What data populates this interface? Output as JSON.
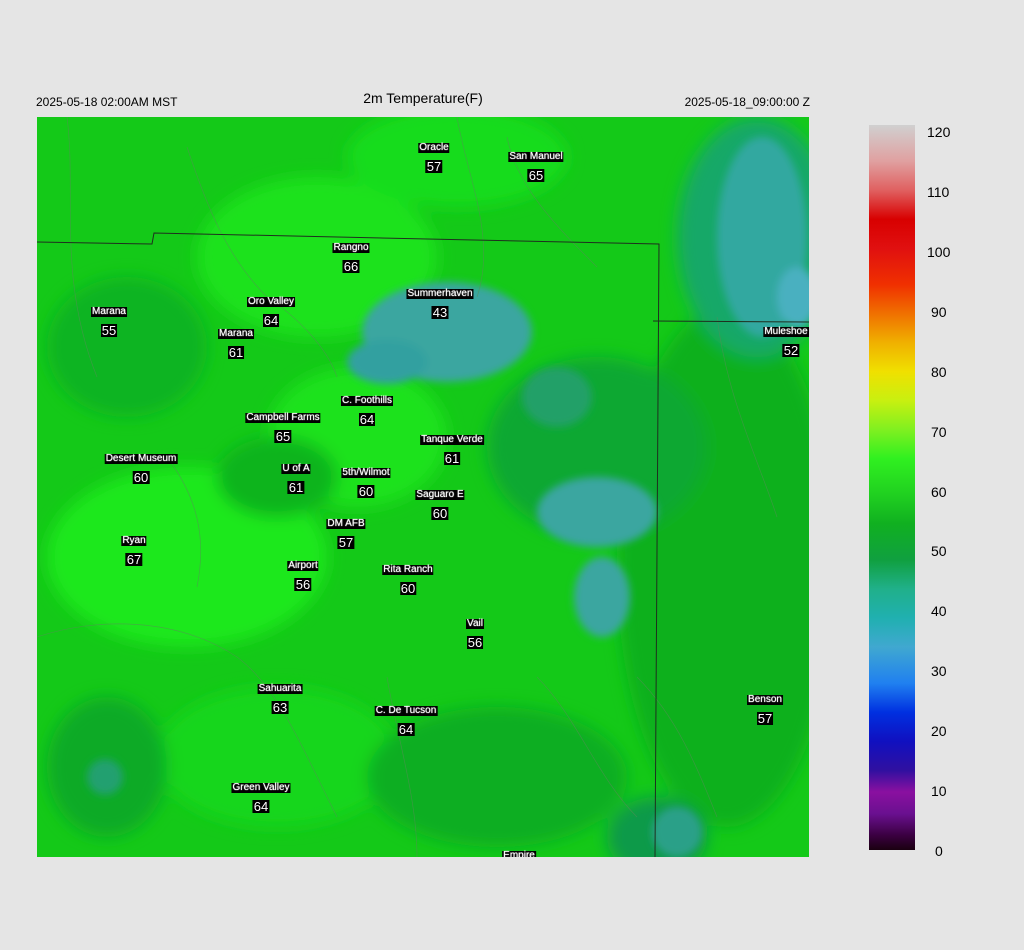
{
  "header": {
    "local_time": "2025-05-18 02:00AM MST",
    "title": "2m Temperature(F)",
    "valid_time": "2025-05-18_09:00:00 Z"
  },
  "colorbar": {
    "ticks": [
      "120",
      "110",
      "100",
      "90",
      "80",
      "70",
      "60",
      "50",
      "40",
      "30",
      "20",
      "10",
      "0"
    ]
  },
  "stations": [
    {
      "name": "Oracle",
      "value": "57"
    },
    {
      "name": "San Manuel",
      "value": "65"
    },
    {
      "name": "Rangno",
      "value": "66"
    },
    {
      "name": "Summerhaven",
      "value": "43"
    },
    {
      "name": "Marana",
      "value": "55"
    },
    {
      "name": "Oro Valley",
      "value": "64"
    },
    {
      "name": "Marana",
      "value": "61"
    },
    {
      "name": "Muleshoe R",
      "value": "52"
    },
    {
      "name": "C. Foothills",
      "value": "64"
    },
    {
      "name": "Campbell Farms",
      "value": "65"
    },
    {
      "name": "Tanque Verde",
      "value": "61"
    },
    {
      "name": "Desert Museum",
      "value": "60"
    },
    {
      "name": "U of A",
      "value": "61"
    },
    {
      "name": "5th/Wilmot",
      "value": "60"
    },
    {
      "name": "Saguaro E",
      "value": "60"
    },
    {
      "name": "DM AFB",
      "value": "57"
    },
    {
      "name": "Ryan",
      "value": "67"
    },
    {
      "name": "Airport",
      "value": "56"
    },
    {
      "name": "Rita Ranch",
      "value": "60"
    },
    {
      "name": "Vail",
      "value": "56"
    },
    {
      "name": "Sahuarita",
      "value": "63"
    },
    {
      "name": "C. De Tucson",
      "value": "64"
    },
    {
      "name": "Benson",
      "value": "57"
    },
    {
      "name": "Green Valley",
      "value": "64"
    },
    {
      "name": "Empire",
      "value": ""
    }
  ],
  "colors": {
    "cold_area": "#3aa8a0",
    "mid_green": "#10b820",
    "warm_green": "#18d818"
  }
}
